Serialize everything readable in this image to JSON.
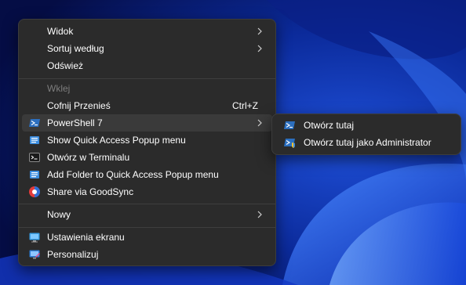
{
  "context_menu": {
    "items": [
      {
        "label": "Widok",
        "submenu": true
      },
      {
        "label": "Sortuj według",
        "submenu": true
      },
      {
        "label": "Odśwież"
      },
      {
        "label": "Wklej",
        "disabled": true
      },
      {
        "label": "Cofnij Przenieś",
        "shortcut": "Ctrl+Z"
      },
      {
        "label": "PowerShell 7",
        "submenu": true,
        "icon": "powershell-icon",
        "highlighted": true
      },
      {
        "label": "Show Quick Access Popup menu",
        "icon": "quick-access-popup-icon"
      },
      {
        "label": "Otwórz w Terminalu",
        "icon": "terminal-icon"
      },
      {
        "label": "Add Folder to Quick Access Popup menu",
        "icon": "quick-access-popup-icon"
      },
      {
        "label": "Share via GoodSync",
        "icon": "goodsync-icon"
      },
      {
        "label": "Nowy",
        "submenu": true
      },
      {
        "label": "Ustawienia ekranu",
        "icon": "display-settings-icon"
      },
      {
        "label": "Personalizuj",
        "icon": "personalize-icon"
      }
    ]
  },
  "powershell_submenu": {
    "items": [
      {
        "label": "Otwórz tutaj",
        "icon": "powershell-icon"
      },
      {
        "label": "Otwórz tutaj jako Administrator",
        "icon": "powershell-admin-icon"
      }
    ]
  },
  "colors": {
    "menu_bg": "#2b2b2b",
    "highlight": "#3a3a3a",
    "disabled_text": "#7d7d7d"
  }
}
